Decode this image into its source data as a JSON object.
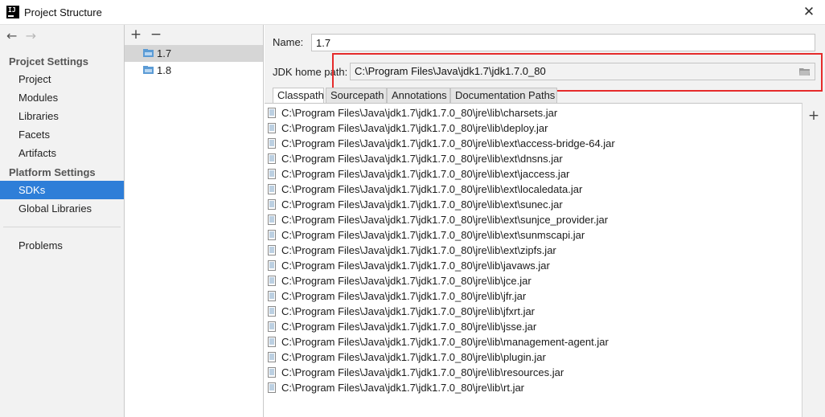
{
  "window": {
    "title": "Project Structure",
    "logo_text": "IJ",
    "close_glyph": "✕"
  },
  "nav": {
    "back_glyph": "←",
    "forward_glyph": "→"
  },
  "sidebar": {
    "project_settings_header": "Projcet Settings",
    "project_items": [
      "Project",
      "Modules",
      "Libraries",
      "Facets",
      "Artifacts"
    ],
    "platform_settings_header": "Platform Settings",
    "platform_items": [
      "SDKs",
      "Global Libraries"
    ],
    "selected": "SDKs",
    "extra_items": [
      "Problems"
    ]
  },
  "sdk_list": {
    "add_glyph": "+",
    "remove_glyph": "−",
    "items": [
      "1.7",
      "1.8"
    ],
    "selected": "1.7"
  },
  "details": {
    "name_label": "Name:",
    "name_value": "1.7",
    "home_label": "JDK home path:",
    "home_value": "C:\\Program Files\\Java\\jdk1.7\\jdk1.7.0_80",
    "highlight_color": "#e52b2b"
  },
  "tabs": {
    "items": [
      "Classpath",
      "Sourcepath",
      "Annotations",
      "Documentation Paths"
    ],
    "active": "Classpath"
  },
  "classpath": [
    "C:\\Program Files\\Java\\jdk1.7\\jdk1.7.0_80\\jre\\lib\\charsets.jar",
    "C:\\Program Files\\Java\\jdk1.7\\jdk1.7.0_80\\jre\\lib\\deploy.jar",
    "C:\\Program Files\\Java\\jdk1.7\\jdk1.7.0_80\\jre\\lib\\ext\\access-bridge-64.jar",
    "C:\\Program Files\\Java\\jdk1.7\\jdk1.7.0_80\\jre\\lib\\ext\\dnsns.jar",
    "C:\\Program Files\\Java\\jdk1.7\\jdk1.7.0_80\\jre\\lib\\ext\\jaccess.jar",
    "C:\\Program Files\\Java\\jdk1.7\\jdk1.7.0_80\\jre\\lib\\ext\\localedata.jar",
    "C:\\Program Files\\Java\\jdk1.7\\jdk1.7.0_80\\jre\\lib\\ext\\sunec.jar",
    "C:\\Program Files\\Java\\jdk1.7\\jdk1.7.0_80\\jre\\lib\\ext\\sunjce_provider.jar",
    "C:\\Program Files\\Java\\jdk1.7\\jdk1.7.0_80\\jre\\lib\\ext\\sunmscapi.jar",
    "C:\\Program Files\\Java\\jdk1.7\\jdk1.7.0_80\\jre\\lib\\ext\\zipfs.jar",
    "C:\\Program Files\\Java\\jdk1.7\\jdk1.7.0_80\\jre\\lib\\javaws.jar",
    "C:\\Program Files\\Java\\jdk1.7\\jdk1.7.0_80\\jre\\lib\\jce.jar",
    "C:\\Program Files\\Java\\jdk1.7\\jdk1.7.0_80\\jre\\lib\\jfr.jar",
    "C:\\Program Files\\Java\\jdk1.7\\jdk1.7.0_80\\jre\\lib\\jfxrt.jar",
    "C:\\Program Files\\Java\\jdk1.7\\jdk1.7.0_80\\jre\\lib\\jsse.jar",
    "C:\\Program Files\\Java\\jdk1.7\\jdk1.7.0_80\\jre\\lib\\management-agent.jar",
    "C:\\Program Files\\Java\\jdk1.7\\jdk1.7.0_80\\jre\\lib\\plugin.jar",
    "C:\\Program Files\\Java\\jdk1.7\\jdk1.7.0_80\\jre\\lib\\resources.jar",
    "C:\\Program Files\\Java\\jdk1.7\\jdk1.7.0_80\\jre\\lib\\rt.jar"
  ],
  "classpath_add_glyph": "+",
  "colors": {
    "selection": "#2e7ed8",
    "panel_bg": "#f2f2f2",
    "highlight": "#e52b2b"
  }
}
